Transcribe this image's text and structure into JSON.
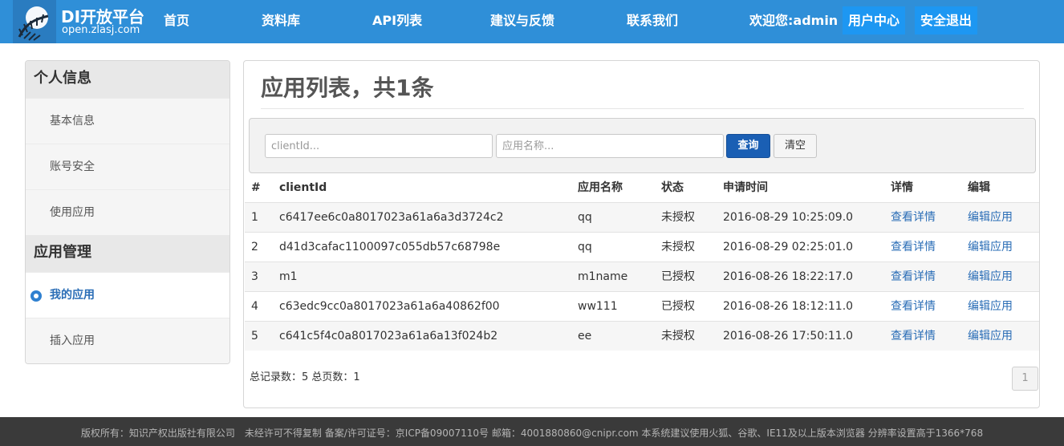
{
  "header": {
    "logo_title": "DI开放平台",
    "logo_sub": "open.zlasj.com",
    "nav": [
      "首页",
      "资料库",
      "API列表",
      "建议与反馈",
      "联系我们"
    ],
    "welcome": "欢迎您:admin",
    "user_center": "用户中心",
    "logout": "安全退出",
    "accent": "#2f8fd8"
  },
  "sidebar": {
    "section1": "个人信息",
    "items1": [
      "基本信息",
      "账号安全",
      "使用应用"
    ],
    "section2": "应用管理",
    "items2": [
      "我的应用",
      "插入应用"
    ],
    "active_item": "我的应用"
  },
  "main": {
    "title": "应用列表，共1条",
    "filter": {
      "client_placeholder": "clientId...",
      "name_placeholder": "应用名称...",
      "query_label": "查询",
      "clear_label": "清空"
    },
    "columns": [
      "#",
      "clientId",
      "应用名称",
      "状态",
      "申请时间",
      "详情",
      "编辑"
    ],
    "rows": [
      {
        "num": "1",
        "client_id": "c6417ee6c0a8017023a61a6a3d3724c2",
        "name": "qq",
        "status": "未授权",
        "time": "2016-08-29 10:25:09.0",
        "detail": "查看详情",
        "edit": "编辑应用"
      },
      {
        "num": "2",
        "client_id": "d41d3cafac1100097c055db57c68798e",
        "name": "qq",
        "status": "未授权",
        "time": "2016-08-29 02:25:01.0",
        "detail": "查看详情",
        "edit": "编辑应用"
      },
      {
        "num": "3",
        "client_id": "m1",
        "name": "m1name",
        "status": "已授权",
        "time": "2016-08-26 18:22:17.0",
        "detail": "查看详情",
        "edit": "编辑应用"
      },
      {
        "num": "4",
        "client_id": "c63edc9cc0a8017023a61a6a40862f00",
        "name": "ww111",
        "status": "已授权",
        "time": "2016-08-26 18:12:11.0",
        "detail": "查看详情",
        "edit": "编辑应用"
      },
      {
        "num": "5",
        "client_id": "c641c5f4c0a8017023a61a6a13f024b2",
        "name": "ee",
        "status": "未授权",
        "time": "2016-08-26 17:50:11.0",
        "detail": "查看详情",
        "edit": "编辑应用"
      }
    ],
    "total_text": "总记录数：5 总页数：1",
    "page": "1"
  },
  "footer": {
    "text": "版权所有：知识产权出版社有限公司　未经许可不得复制  备案/许可证号：京ICP备09007110号  邮箱：4001880860@cnipr.com  本系统建议使用火狐、谷歌、IE11及以上版本浏览器 分辨率设置高于1366*768"
  }
}
